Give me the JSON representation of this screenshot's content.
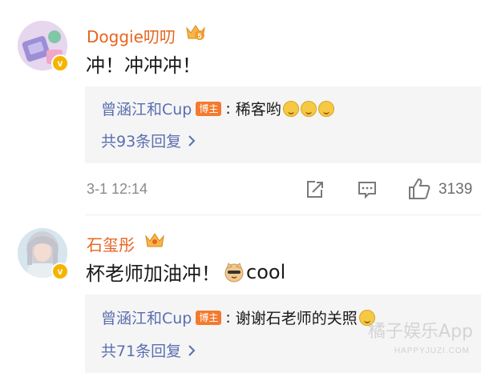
{
  "comments": [
    {
      "username": "Doggie叨叨",
      "crown_level": "5",
      "verified_badge": "v",
      "content": "冲！冲冲冲！",
      "reply": {
        "user": "曾涵江和Cup",
        "tag": "博主",
        "separator": ":",
        "text": "稀客哟"
      },
      "more_replies": "共93条回复",
      "time": "3-1 12:14",
      "likes": "3139"
    },
    {
      "username": "石玺彤",
      "verified_badge": "v",
      "content_before": "杯老师加油冲！",
      "content_after": "cool",
      "reply": {
        "user": "曾涵江和Cup",
        "tag": "博主",
        "separator": ":",
        "text": "谢谢石老师的关照"
      },
      "more_replies": "共71条回复"
    }
  ],
  "watermark": {
    "main": "橘子娱乐App",
    "sub": "HAPPYJUZI.COM"
  },
  "colors": {
    "username": "#e8641f",
    "link": "#5b6fb0",
    "tag_bg": "#f47a2d",
    "verified": "#f4b400"
  }
}
